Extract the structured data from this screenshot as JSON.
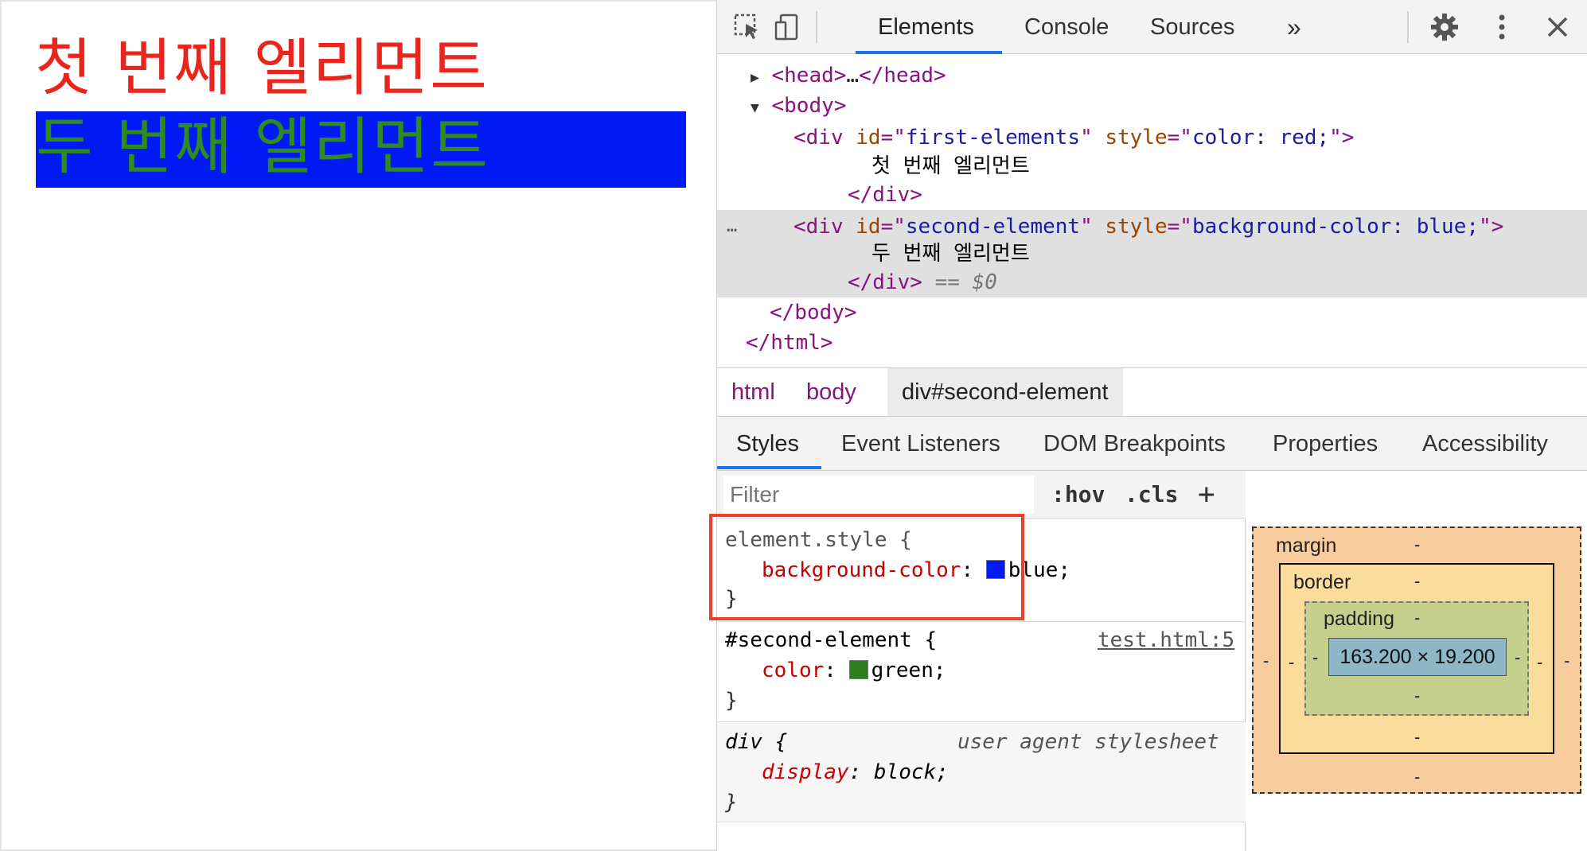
{
  "page": {
    "first_element_text": "첫 번째 엘리먼트",
    "second_element_text": "두 번째 엘리먼트",
    "colors": {
      "first_text": "#e8261e",
      "second_bg": "#0019f5",
      "second_text": "#2e8b1e"
    }
  },
  "devtools": {
    "toolbar": {
      "icons": [
        "inspect-icon",
        "device-toolbar-icon",
        "more-tabs-icon",
        "settings-icon",
        "kebab-menu-icon",
        "close-icon"
      ],
      "tabs": [
        "Elements",
        "Console",
        "Sources"
      ],
      "more_tabs": "»",
      "active_tab": "Elements"
    },
    "dom": {
      "head_open": "<head>",
      "head_ellipsis": "…",
      "head_close": "</head>",
      "body_open": "<body>",
      "div1_tag": "div",
      "div1_id_attr": "id",
      "div1_id_val": "first-elements",
      "div1_style_attr": "style",
      "div1_style_val": "color: red;",
      "div1_text": "첫 번째 엘리먼트",
      "div1_close": "</div>",
      "div2_tag": "div",
      "div2_id_attr": "id",
      "div2_id_val": "second-element",
      "div2_style_attr": "style",
      "div2_style_val": "background-color: blue;",
      "div2_text": "두 번째 엘리먼트",
      "div2_close": "</div>",
      "selected_marker": "== $0",
      "row_menu": "…",
      "body_close": "</body>",
      "html_close": "</html>"
    },
    "breadcrumbs": [
      "html",
      "body",
      "div#second-element"
    ],
    "subtabs": [
      "Styles",
      "Event Listeners",
      "DOM Breakpoints",
      "Properties",
      "Accessibility"
    ],
    "filter": {
      "placeholder": "Filter",
      "hov": ":hov",
      "cls": ".cls",
      "add": "+"
    },
    "rules": {
      "element_style": {
        "selector": "element.style {",
        "prop": "background-color",
        "value": "blue;",
        "swatch": "#0019f5",
        "close": "}"
      },
      "second_element": {
        "selector": "#second-element {",
        "source": "test.html:5",
        "prop": "color",
        "value": "green;",
        "swatch": "#2e7d1e",
        "close": "}"
      },
      "user_agent": {
        "selector": "div {",
        "source": "user agent stylesheet",
        "prop": "display",
        "value": "block;",
        "close": "}"
      }
    },
    "box_model": {
      "margin_label": "margin",
      "border_label": "border",
      "padding_label": "padding",
      "content_size": "163.200 × 19.200",
      "dash": "-"
    }
  }
}
